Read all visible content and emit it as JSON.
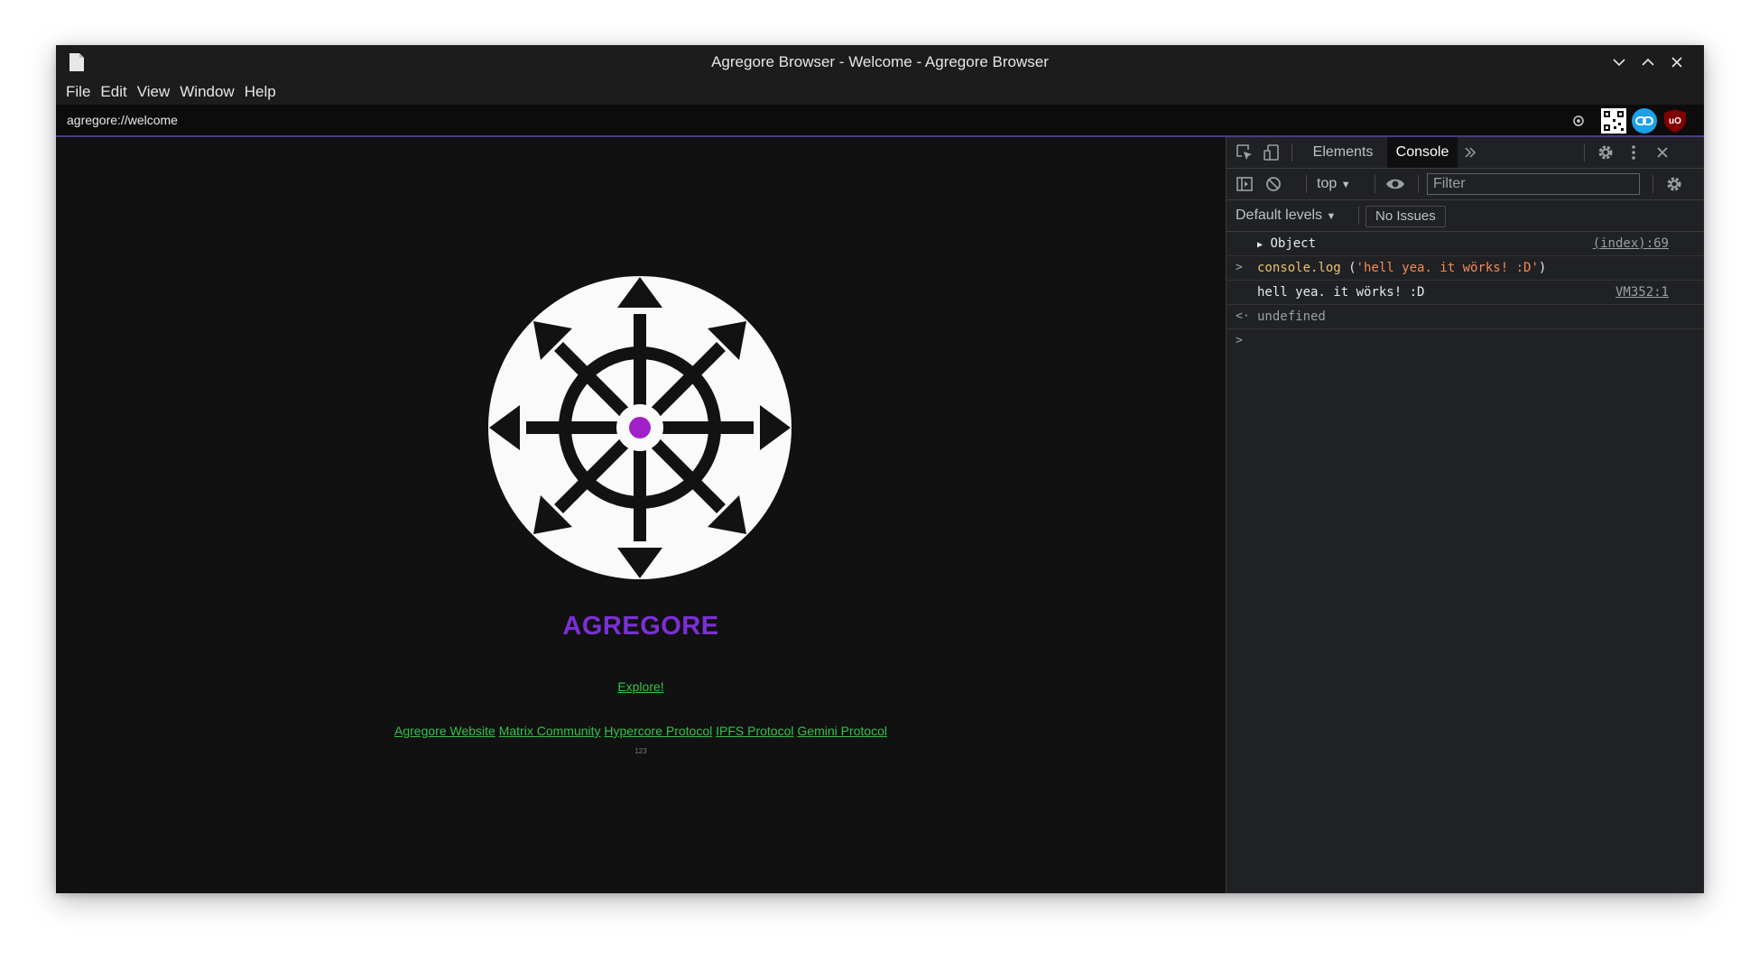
{
  "window": {
    "title": "Agregore Browser - Welcome - Agregore Browser",
    "menu": [
      "File",
      "Edit",
      "View",
      "Window",
      "Help"
    ]
  },
  "urlbar": {
    "url": "agregore://welcome"
  },
  "page": {
    "brand": "AGREGORE",
    "explore_label": "Explore!",
    "links": [
      "Agregore Website",
      "Matrix Community",
      "Hypercore Protocol",
      "IPFS Protocol",
      "Gemini Protocol"
    ],
    "version_text": "123",
    "accent_color": "#7b2fd6",
    "link_color": "#35c24a"
  },
  "devtools": {
    "tabs": [
      "Elements",
      "Console"
    ],
    "active_tab": "Console",
    "context": "top",
    "filter_placeholder": "Filter",
    "levels": "Default levels",
    "issues": "No Issues",
    "console": {
      "object_label": "Object",
      "object_source": "(index):69",
      "command_name": "console.log",
      "command_arg": "'hell yea. it wörks! :D'",
      "log_output": "hell yea. it wörks! :D",
      "log_source": "VM352:1",
      "return_value": "undefined"
    }
  }
}
